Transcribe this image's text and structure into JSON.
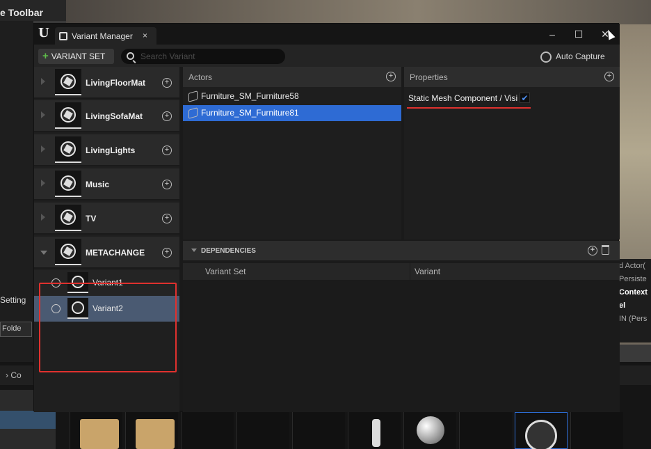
{
  "background": {
    "toolbar_title": "e Toolbar",
    "settings_label": "Setting",
    "folder_label": "Folde",
    "content_label": "Co",
    "right_panel": [
      "d Actor(",
      "Persiste",
      "Context",
      "el",
      "IN (Pers"
    ]
  },
  "window": {
    "tab_title": "Variant Manager",
    "tab_close": "×",
    "minimize": "–",
    "maximize": "☐",
    "close": "✕"
  },
  "toolbar": {
    "add_variant_set": "VARIANT SET",
    "search_placeholder": "Search Variant",
    "auto_capture": "Auto Capture"
  },
  "variant_sets": [
    {
      "name": "LivingFloorMat"
    },
    {
      "name": "LivingSofaMat"
    },
    {
      "name": "LivingLights"
    },
    {
      "name": "Music"
    },
    {
      "name": "TV"
    },
    {
      "name": "METACHANGE"
    }
  ],
  "variants": [
    {
      "name": "Variant1"
    },
    {
      "name": "Variant2"
    }
  ],
  "actors": {
    "header": "Actors",
    "items": [
      "Furniture_SM_Furniture58",
      "Furniture_SM_Furniture81"
    ],
    "selected_index": 1
  },
  "properties": {
    "header": "Properties",
    "items": [
      {
        "label": "Static Mesh Component / Visi",
        "checked": true
      }
    ]
  },
  "dependencies": {
    "header": "DEPENDENCIES",
    "columns": [
      "Variant Set",
      "Variant"
    ]
  },
  "colors": {
    "selection_blue": "#2e6bd4",
    "highlight_red": "#e0312e",
    "add_green": "#5fbf4a"
  }
}
